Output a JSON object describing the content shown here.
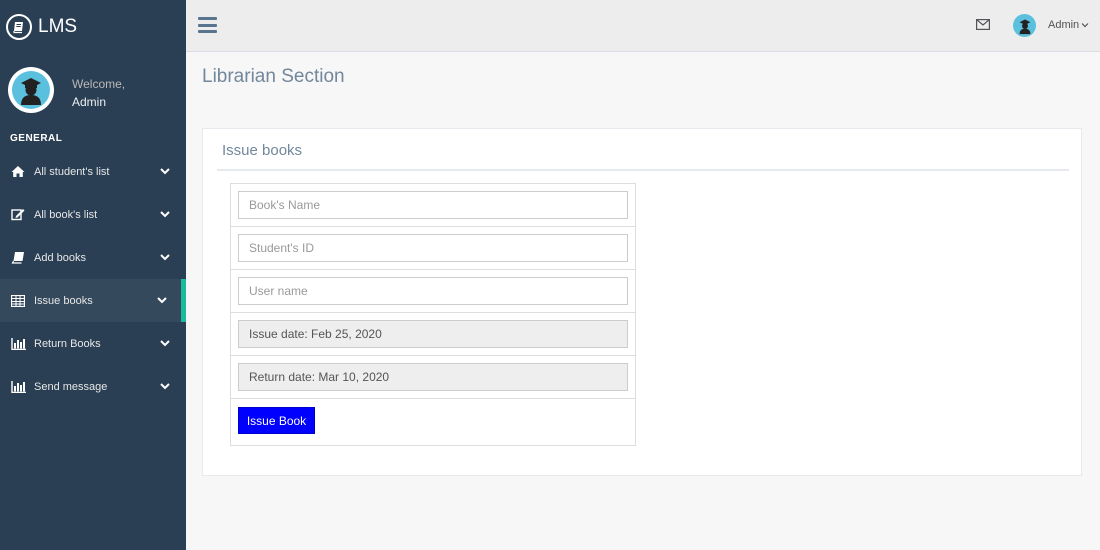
{
  "brand": {
    "name": "LMS",
    "icon": "book-icon"
  },
  "profile": {
    "welcome": "Welcome,",
    "name": "Admin",
    "avatar_icon": "graduate-icon"
  },
  "sidebar": {
    "section_title": "GENERAL",
    "active_index": 3,
    "accent_color": "#1abb9c",
    "items": [
      {
        "label": "All student's list",
        "icon": "home-icon"
      },
      {
        "label": "All book's list",
        "icon": "edit-icon"
      },
      {
        "label": "Add books",
        "icon": "book-icon"
      },
      {
        "label": "Issue books",
        "icon": "table-icon"
      },
      {
        "label": "Return Books",
        "icon": "bar-chart-icon"
      },
      {
        "label": "Send message",
        "icon": "bar-chart-icon"
      }
    ]
  },
  "topnav": {
    "user": "Admin",
    "mail_icon": "envelope-icon",
    "menu_icon": "hamburger-icon"
  },
  "page": {
    "title": "Librarian Section"
  },
  "panel": {
    "title": "Issue books"
  },
  "form": {
    "book_name_placeholder": "Book's Name",
    "student_id_placeholder": "Student's ID",
    "user_name_placeholder": "User name",
    "issue_date_value": "Issue date: Feb 25, 2020",
    "return_date_value": "Return date: Mar 10, 2020",
    "submit_label": "Issue Book",
    "submit_color": "#0000ff"
  }
}
